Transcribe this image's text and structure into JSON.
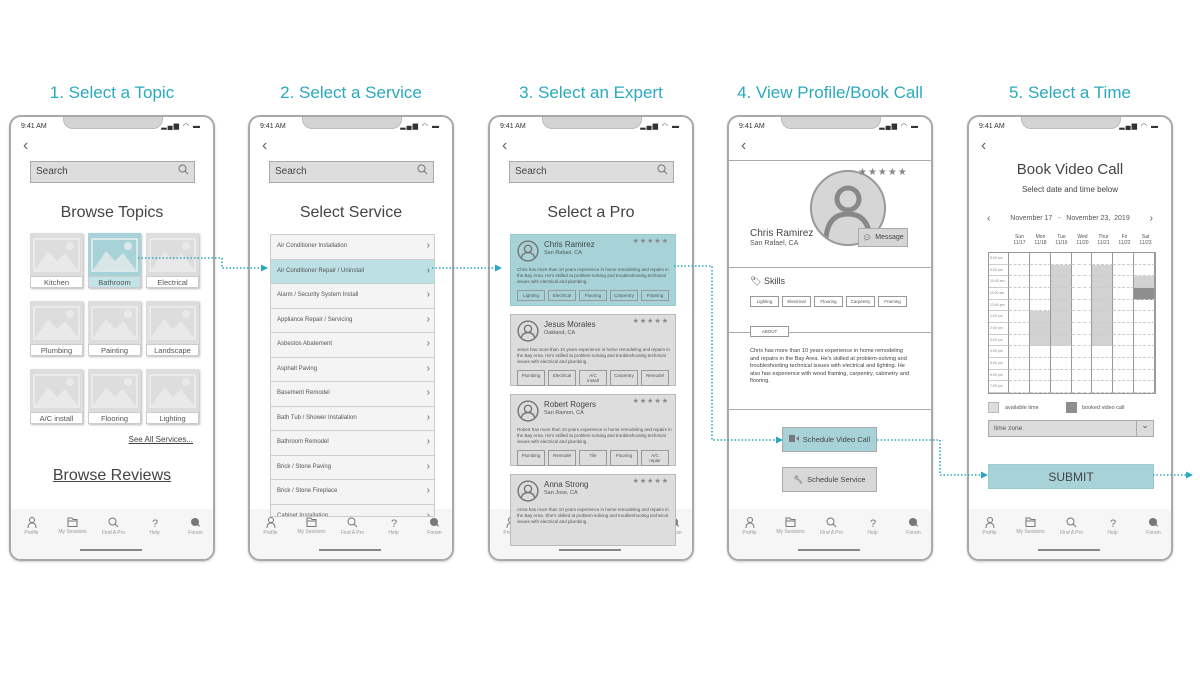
{
  "colors": {
    "accent": "#2aa9be",
    "selected": "#a7d3d8",
    "available": "#d2d2d2",
    "booked": "#8e8e8e"
  },
  "steps": [
    "1. Select a Topic",
    "2. Select a Service",
    "3. Select an Expert",
    "4. View Profile/Book Call",
    "5. Select a Time"
  ],
  "status": {
    "time": "9:41 AM",
    "icons": "signal wifi battery"
  },
  "nav": [
    {
      "label": "Profile",
      "icon": "profile-icon"
    },
    {
      "label": "My Sessions",
      "icon": "folder-icon"
    },
    {
      "label": "Find A Pro",
      "icon": "search-icon"
    },
    {
      "label": "Help",
      "icon": "help-icon"
    },
    {
      "label": "Forum",
      "icon": "forum-icon"
    }
  ],
  "search": {
    "placeholder": "Search"
  },
  "screen1": {
    "title": "Browse Topics",
    "topics": [
      "Kitchen",
      "Bathroom",
      "Electrical",
      "Plumbing",
      "Painting",
      "Landscape",
      "A/C install",
      "Flooring",
      "Lighting"
    ],
    "selected": "Bathroom",
    "see_all": "See All Services...",
    "browse_reviews": "Browse Reviews"
  },
  "screen2": {
    "title": "Select Service",
    "services": [
      "Air Conditioner Installation",
      "Air Conditioner Repair / Uninstall",
      "Alarm / Security System Install",
      "Appliance Repair / Servicing",
      "Asbestos Abatement",
      "Asphalt Paving",
      "Basement Remodel",
      "Bath Tub / Shower Installation",
      "Bathroom Remodel",
      "Brick / Stone Paving",
      "Brick / Stone Fireplace",
      "Cabinet Installation"
    ],
    "selected": "Air Conditioner Repair / Uninstall"
  },
  "screen3": {
    "title": "Select a Pro",
    "stars": "★★★★★",
    "pros": [
      {
        "name": "Chris Ramirez",
        "location": "San Rafael, CA",
        "desc": "Chris has more than 10 years experience in home remodeling and repairs in the Bay Area.  He's skilled at problem-solving and troubleshooting technical issues with electrical and plumbing.",
        "skills": [
          "Lighting",
          "Electrical",
          "Flooring",
          "Carpentry",
          "Framing"
        ],
        "selected": true
      },
      {
        "name": "Jesus Morales",
        "location": "Oakland, CA",
        "desc": "Jesus has more than 10 years experience in home remodeling and repairs in the Bay Area.  He's skilled at problem-solving and troubleshooting technical issues with electrical and plumbing.",
        "skills": [
          "Plumbing",
          "Electrical",
          "A/C install",
          "Carpentry",
          "Remodel"
        ]
      },
      {
        "name": "Robert Rogers",
        "location": "San Ramon, CA",
        "desc": "Robert has more than 10 years experience in home remodeling and repairs in the Bay Area.  He's skilled at problem-solving and troubleshooting technical issues with electrical and plumbing.",
        "skills": [
          "Plumbing",
          "Remodel",
          "Tile",
          "Flooring",
          "A/C repair"
        ]
      },
      {
        "name": "Anna Strong",
        "location": "San Jose, CA",
        "desc": "Anna has more than 10 years experience in home remodeling and repairs in the Bay Area.  She's skilled at problem-solving and troubleshooting technical issues with electrical and plumbing.",
        "skills": []
      }
    ]
  },
  "screen4": {
    "name": "Chris Ramirez",
    "location": "San Rafael, CA",
    "stars": "★★★★★",
    "message": "Message",
    "skills_label": "Skills",
    "skills": [
      "Lighting",
      "Electrical",
      "Flooring",
      "Carpentry",
      "Framing"
    ],
    "about_label": "ABOUT",
    "about": "Chris has more than 10 years experience in home remodeling and repairs in the Bay Area.  He's skilled at problem-solving and troubleshooting technical issues with electrical and lighting. He also has experience with wood framing, carpentry, cabinetry and flooring.",
    "video_call": "Schedule Video Call",
    "service": "Schedule Service"
  },
  "screen5": {
    "title": "Book Video Call",
    "subtitle": "Select date and time below",
    "range": "November 17   -   November 23,  2019",
    "days": [
      {
        "d": "Sun",
        "date": "11/17"
      },
      {
        "d": "Mon",
        "date": "11/18"
      },
      {
        "d": "Tue",
        "date": "11/19"
      },
      {
        "d": "Wed",
        "date": "11/20"
      },
      {
        "d": "Thur",
        "date": "11/21"
      },
      {
        "d": "Fri",
        "date": "11/22"
      },
      {
        "d": "Sat",
        "date": "11/23"
      }
    ],
    "times": [
      "8:00 am",
      "9:00 am",
      "10:00 am",
      "11:00 am",
      "12:00 pm",
      "1:00 pm",
      "2:00 pm",
      "3:00 pm",
      "4:00 pm",
      "5:00 pm",
      "6:00 pm",
      "7:00 pm"
    ],
    "available": {
      "Mon": [
        "1:00 pm",
        "2:00 pm",
        "3:00 pm"
      ],
      "Tue": [
        "9:00 am",
        "10:00 am",
        "11:00 am",
        "12:00 pm",
        "1:00 pm",
        "2:00 pm",
        "3:00 pm"
      ],
      "Thur": [
        "9:00 am",
        "10:00 am",
        "11:00 am",
        "12:00 pm",
        "1:00 pm",
        "2:00 pm",
        "3:00 pm"
      ],
      "Sat": [
        "10:00 am"
      ]
    },
    "booked": {
      "Sat": [
        "11:00 am"
      ]
    },
    "legend_available": "available time",
    "legend_booked": "booked video call",
    "timezone": "time zone",
    "submit": "SUBMIT"
  }
}
